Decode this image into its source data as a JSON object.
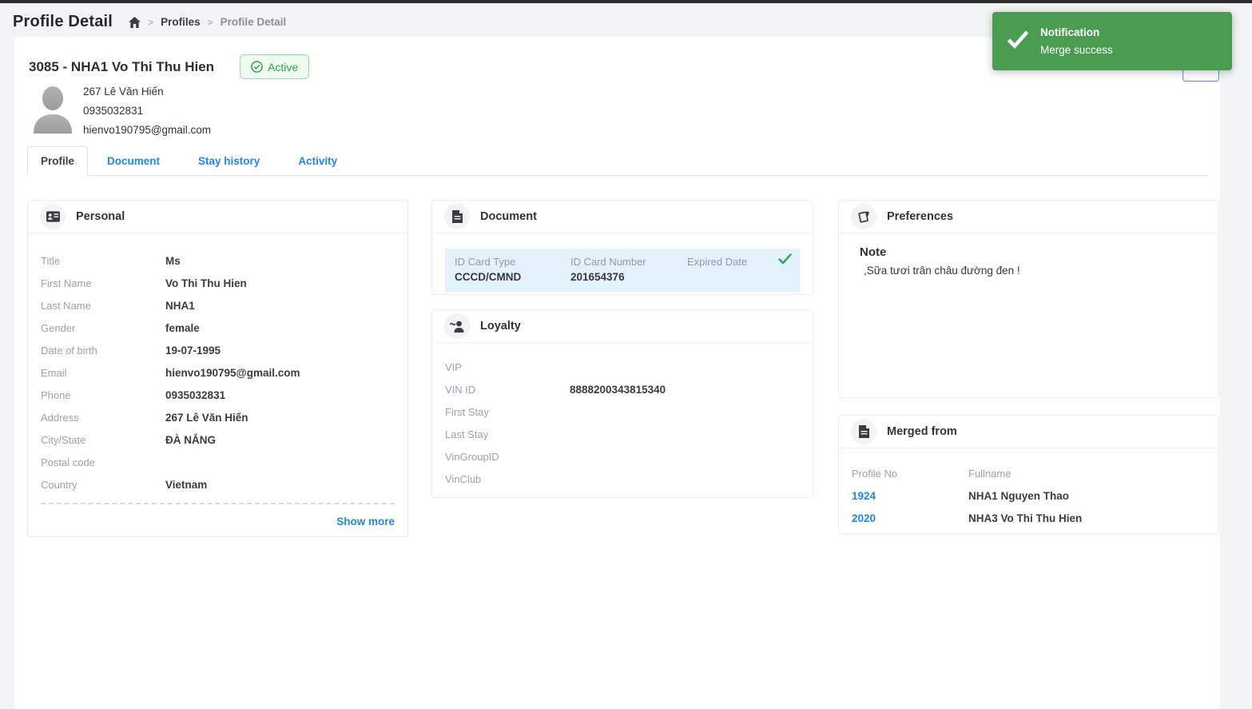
{
  "page": {
    "title": "Profile Detail",
    "breadcrumb": {
      "items": [
        "Profiles",
        "Profile Detail"
      ]
    }
  },
  "toast": {
    "title": "Notification",
    "message": "Merge success",
    "bg_color": "#4a9d50",
    "icon": "check-icon"
  },
  "profile_header": {
    "name": "3085 - NHA1 Vo Thi Thu Hien",
    "status": "Active",
    "status_color": "#2fa351",
    "address": "267 Lê Văn Hiến",
    "phone": "0935032831",
    "email": "hienvo190795@gmail.com"
  },
  "tabs": [
    {
      "label": "Profile",
      "active": true
    },
    {
      "label": "Document",
      "active": false
    },
    {
      "label": "Stay history",
      "active": false
    },
    {
      "label": "Activity",
      "active": false
    }
  ],
  "personal": {
    "title": "Personal",
    "icon": "id-card-icon",
    "fields": [
      {
        "label": "Title",
        "value": "Ms"
      },
      {
        "label": "First Name",
        "value": "Vo Thi Thu Hien"
      },
      {
        "label": "Last Name",
        "value": "NHA1"
      },
      {
        "label": "Gender",
        "value": "female"
      },
      {
        "label": "Date of birth",
        "value": "19-07-1995"
      },
      {
        "label": "Email",
        "value": "hienvo190795@gmail.com"
      },
      {
        "label": "Phone",
        "value": "0935032831"
      },
      {
        "label": "Address",
        "value": "267 Lê Văn Hiến"
      },
      {
        "label": "City/State",
        "value": "ĐÀ NẴNG"
      },
      {
        "label": "Postal code",
        "value": ""
      },
      {
        "label": "Country",
        "value": "Vietnam"
      }
    ],
    "show_more": "Show more"
  },
  "document": {
    "title": "Document",
    "icon": "file-icon",
    "columns": [
      "ID Card Type",
      "ID Card Number",
      "Expired Date"
    ],
    "rows": [
      {
        "type": "CCCD/CMND",
        "number": "201654376",
        "expired": "",
        "verified_icon": "check-icon"
      }
    ],
    "row_highlight_color": "#e4f2fc",
    "check_color": "#27a35a"
  },
  "loyalty": {
    "title": "Loyalty",
    "icon": "member-icon",
    "fields": [
      {
        "label": "VIP",
        "value": ""
      },
      {
        "label": "VIN ID",
        "value": "8888200343815340"
      },
      {
        "label": "First Stay",
        "value": ""
      },
      {
        "label": "Last Stay",
        "value": ""
      },
      {
        "label": "VinGroupID",
        "value": ""
      },
      {
        "label": "VinClub",
        "value": ""
      }
    ]
  },
  "preferences": {
    "title": "Preferences",
    "icon": "notes-icon",
    "note_label": "Note",
    "note": ",Sữa tươi trân châu đường đen !"
  },
  "merged_from": {
    "title": "Merged from",
    "icon": "file-icon",
    "columns": [
      "Profile No",
      "Fullname"
    ],
    "rows": [
      {
        "no": "1924",
        "fullname": "NHA1 Nguyen Thao"
      },
      {
        "no": "2020",
        "fullname": "NHA3 Vo Thi Thu Hien"
      }
    ],
    "link_color": "#1f87e8"
  }
}
